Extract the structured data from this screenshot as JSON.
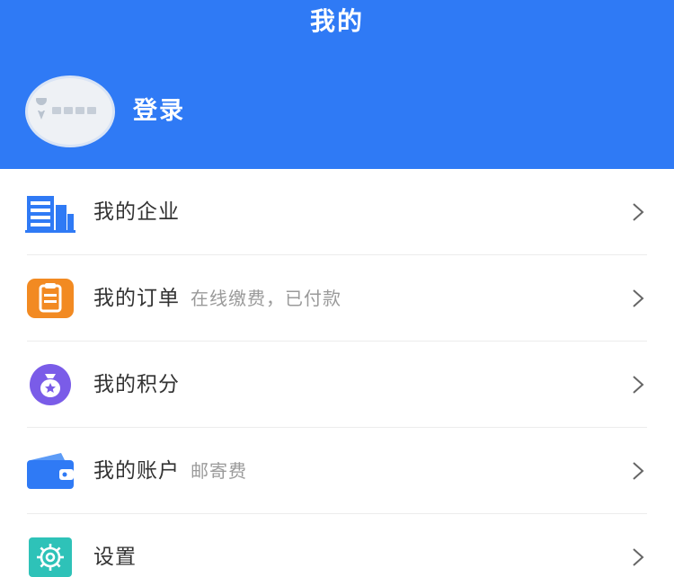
{
  "header": {
    "title": "我的",
    "login_label": "登录",
    "background_color": "#2f7af5"
  },
  "menu": {
    "items": [
      {
        "id": "enterprise",
        "label": "我的企业",
        "subtitle": "",
        "icon": "building-icon",
        "icon_color": "#2f7af5"
      },
      {
        "id": "orders",
        "label": "我的订单",
        "subtitle": "在线缴费，已付款",
        "icon": "clipboard-icon",
        "icon_color": "#f28a22"
      },
      {
        "id": "points",
        "label": "我的积分",
        "subtitle": "",
        "icon": "money-bag-icon",
        "icon_color": "#7a5ce8"
      },
      {
        "id": "account",
        "label": "我的账户",
        "subtitle": "邮寄费",
        "icon": "wallet-icon",
        "icon_color": "#2f7af5"
      },
      {
        "id": "settings",
        "label": "设置",
        "subtitle": "",
        "icon": "gear-icon",
        "icon_color": "#2ec2b8"
      }
    ]
  }
}
